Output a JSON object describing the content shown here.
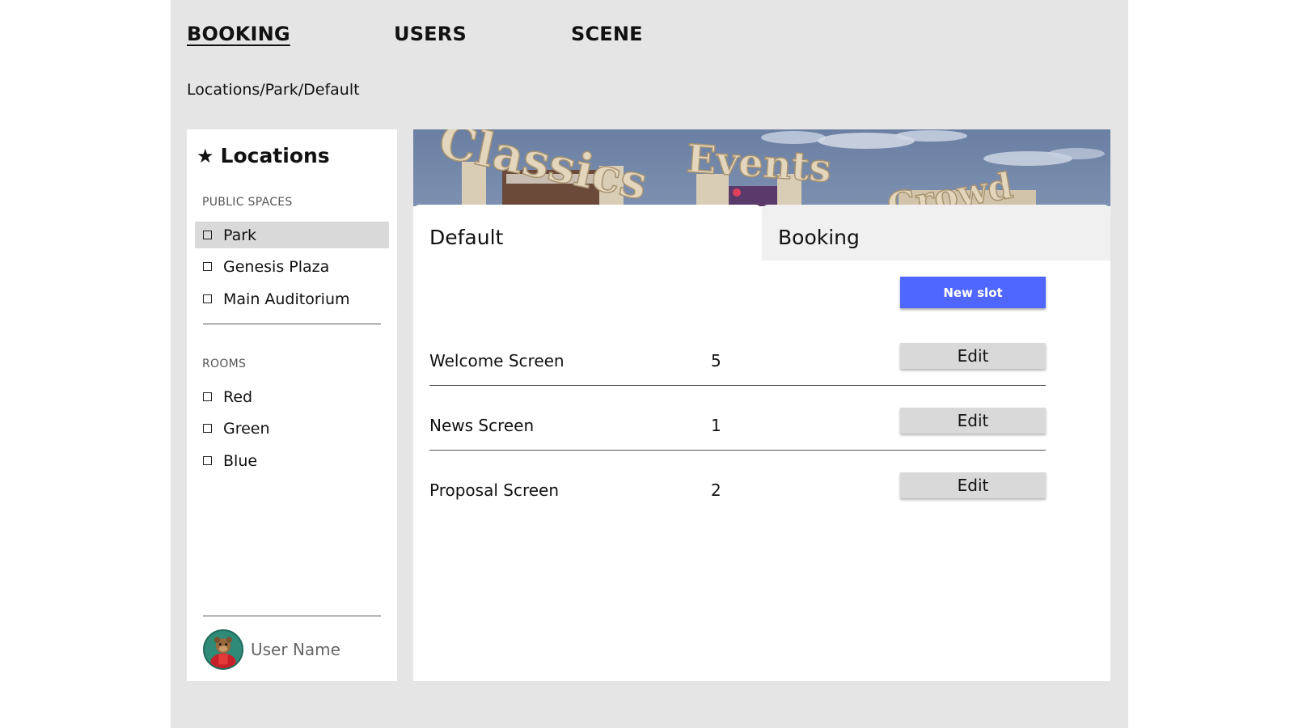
{
  "nav": {
    "tabs": [
      {
        "label": "BOOKING",
        "active": true
      },
      {
        "label": "USERS",
        "active": false
      },
      {
        "label": "SCENE",
        "active": false
      }
    ]
  },
  "breadcrumb": "Locations/Park/Default",
  "sidebar": {
    "title_icon": "star-icon",
    "title": "Locations",
    "sections": [
      {
        "heading": "PUBLIC SPACES",
        "items": [
          {
            "label": "Park",
            "selected": true
          },
          {
            "label": "Genesis Plaza",
            "selected": false
          },
          {
            "label": "Main Auditorium",
            "selected": false
          }
        ]
      },
      {
        "heading": "ROOMS",
        "items": [
          {
            "label": "Red",
            "selected": false
          },
          {
            "label": "Green",
            "selected": false
          },
          {
            "label": "Blue",
            "selected": false
          }
        ]
      }
    ],
    "user": {
      "name": "User Name"
    }
  },
  "banner": {
    "signs": [
      "Classics",
      "Events",
      "Crowd"
    ]
  },
  "main": {
    "tabs": [
      {
        "label": "Default",
        "active": true
      },
      {
        "label": "Booking",
        "active": false
      }
    ],
    "new_slot_label": "New slot",
    "rows": [
      {
        "name": "Welcome Screen",
        "count": "5",
        "action": "Edit"
      },
      {
        "name": "News Screen",
        "count": "1",
        "action": "Edit"
      },
      {
        "name": "Proposal Screen",
        "count": "2",
        "action": "Edit"
      }
    ]
  },
  "colors": {
    "accent": "#4f66ff",
    "page_bg": "#e5e5e5",
    "selected_item": "#d9d9d9"
  }
}
